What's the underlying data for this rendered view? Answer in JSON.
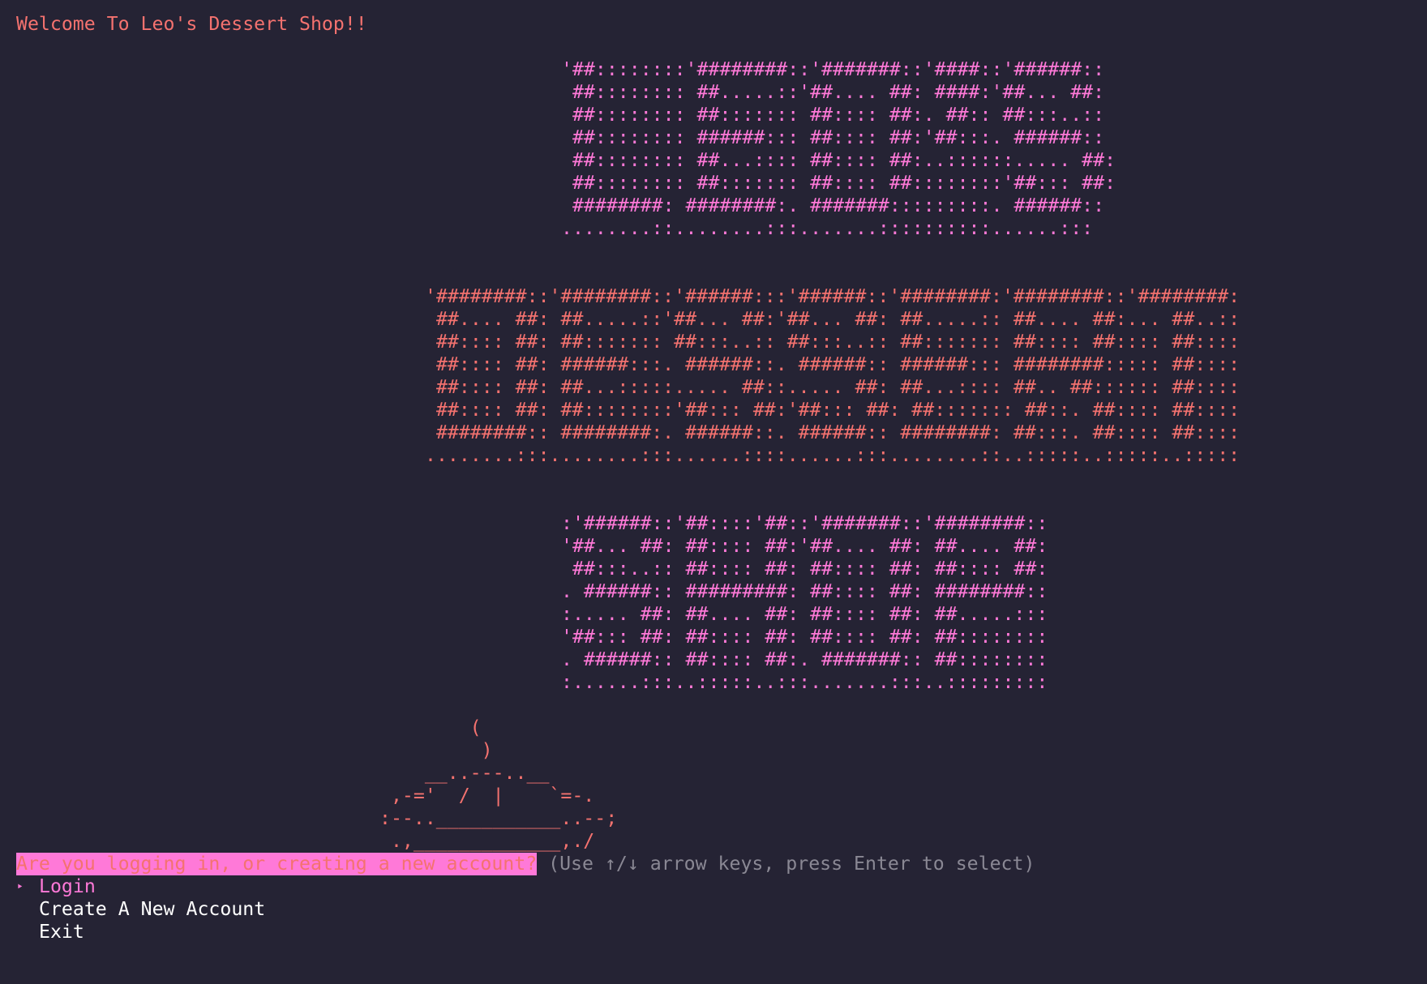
{
  "header": {
    "welcome": "Welcome To Leo's Dessert Shop!!"
  },
  "banner": {
    "leos": "'##::::::::'########::'#######::'####::'######::\n ##:::::::: ##.....::'##.... ##: ####:'##... ##:\n ##:::::::: ##::::::: ##:::: ##:. ##:: ##:::..::\n ##:::::::: ######::: ##:::: ##:'##:::. ######::\n ##:::::::: ##...:::: ##:::: ##:..::::::..... ##:\n ##:::::::: ##::::::: ##:::: ##::::::::'##::: ##:\n ########: ########:. #######:::::::::. ######::\n........::........:::.......::::::::::......:::",
    "dessert": "'########::'########::'######:::'######::'########:'########::'########:\n ##.... ##: ##.....::'##... ##:'##... ##: ##.....:: ##.... ##:... ##..::\n ##:::: ##: ##::::::: ##:::..:: ##:::..:: ##::::::: ##:::: ##:::: ##::::\n ##:::: ##: ######:::. ######::. ######:: ######::: ########::::: ##::::\n ##:::: ##: ##...:::::..... ##::..... ##: ##...:::: ##.. ##:::::: ##::::\n ##:::: ##: ##::::::::'##::: ##:'##::: ##: ##::::::: ##::. ##:::: ##::::\n ########:: ########:. ######::. ######:: ########: ##:::. ##:::: ##::::\n........:::........:::......::::......:::........::..:::::..:::::..:::::",
    "shop": ":'######::'##::::'##::'#######::'########::\n'##... ##: ##:::: ##:'##.... ##: ##.... ##:\n ##:::..:: ##:::: ##: ##:::: ##: ##:::: ##:\n. ######:: #########: ##:::: ##: ########::\n:..... ##: ##.... ##: ##:::: ##: ##.....:::\n'##::: ##: ##:::: ##: ##:::: ##: ##::::::::\n. ######:: ##:::: ##:. #######:: ##::::::::\n:......:::..:::::..:::.......:::..:::::::::",
    "pie": "        (\n         )\n    __..---..__\n ,-='  /  |    `=-.\n:--..___________..--;\n .,_____________,./"
  },
  "prompt": {
    "question": "Are you logging in, or creating a new account?",
    "hint": " (Use ↑/↓ arrow keys, press Enter to select)"
  },
  "menu": {
    "cursor": "‣",
    "items": [
      {
        "label": "Login",
        "selected": true
      },
      {
        "label": "Create A New Account",
        "selected": false
      },
      {
        "label": "Exit",
        "selected": false
      }
    ]
  },
  "colors": {
    "background": "#252334",
    "pink": "#ff79d8",
    "coral": "#f4726f",
    "hint": "#8a8894",
    "text": "#ffffff"
  }
}
